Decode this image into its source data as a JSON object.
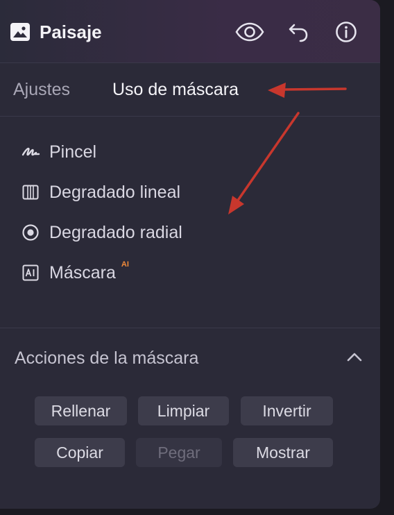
{
  "header": {
    "title": "Paisaje",
    "icons": [
      "image-icon",
      "eye-icon",
      "undo-icon",
      "info-icon"
    ]
  },
  "tabs": [
    {
      "label": "Ajustes",
      "active": false
    },
    {
      "label": "Uso de máscara",
      "active": true
    }
  ],
  "tools": [
    {
      "label": "Pincel",
      "icon": "brush-icon"
    },
    {
      "label": "Degradado lineal",
      "icon": "linear-gradient-icon"
    },
    {
      "label": "Degradado radial",
      "icon": "radial-gradient-icon"
    },
    {
      "label": "Máscara",
      "icon": "ai-mask-icon",
      "badge": "AI"
    }
  ],
  "actions": {
    "title": "Acciones de la máscara",
    "buttons": [
      {
        "label": "Rellenar",
        "enabled": true
      },
      {
        "label": "Limpiar",
        "enabled": true
      },
      {
        "label": "Invertir",
        "enabled": true
      },
      {
        "label": "Copiar",
        "enabled": true
      },
      {
        "label": "Pegar",
        "enabled": false
      },
      {
        "label": "Mostrar",
        "enabled": true
      }
    ]
  },
  "colors": {
    "panel": "#2b2a38",
    "annotation_arrow": "#c8372d",
    "ai_badge": "#f08a3a"
  }
}
